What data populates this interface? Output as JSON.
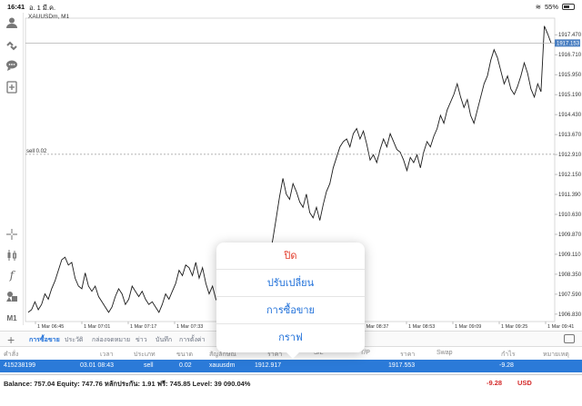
{
  "status_bar": {
    "time": "16:41",
    "date": "อ. 1 มี.ค.",
    "battery": "55%"
  },
  "chart": {
    "symbol_title": "XAUUSDm, M1",
    "sell_line_label": "sell 0.02",
    "current_price_label": "1917.153"
  },
  "sidebar": {
    "timeframe_label": "M1"
  },
  "chart_data": {
    "type": "line",
    "title": "XAUUSDm, M1",
    "y_ticks": [
      "1917.470",
      "1916.710",
      "1915.950",
      "1915.190",
      "1914.430",
      "1913.670",
      "1912.910",
      "1912.150",
      "1911.390",
      "1910.630",
      "1909.870",
      "1909.110",
      "1908.350",
      "1907.590",
      "1906.830"
    ],
    "x_ticks": [
      "1 Mar 06:45",
      "1 Mar 07:01",
      "1 Mar 07:17",
      "1 Mar 07:33",
      "1 Mar 07:49",
      "1 Mar 08:05",
      "1 Mar 08:21",
      "1 Mar 08:37",
      "1 Mar 08:53",
      "1 Mar 09:09",
      "1 Mar 09:25",
      "1 Mar 09:41"
    ],
    "ylim": [
      1906.55,
      1918.1
    ],
    "sell_level": 1912.917,
    "current_price": 1917.153,
    "series": [
      {
        "values": [
          1906.9,
          1907.0,
          1907.3,
          1907.0,
          1907.2,
          1907.6,
          1907.4,
          1907.8,
          1908.1,
          1908.5,
          1908.9,
          1909.0,
          1908.7,
          1908.8,
          1908.2,
          1907.9,
          1907.8,
          1908.4,
          1907.9,
          1907.7,
          1907.9,
          1907.5,
          1907.3,
          1907.1,
          1906.9,
          1907.1,
          1907.5,
          1907.8,
          1907.6,
          1907.2,
          1907.4,
          1907.9,
          1907.7,
          1907.5,
          1907.7,
          1907.4,
          1907.2,
          1907.3,
          1907.1,
          1906.9,
          1907.2,
          1907.6,
          1907.4,
          1907.7,
          1908.0,
          1908.5,
          1908.3,
          1908.7,
          1908.6,
          1908.3,
          1908.8,
          1908.2,
          1908.6,
          1908.0,
          1907.6,
          1907.9,
          1907.4,
          1907.2,
          1906.9,
          1907.1,
          1906.95,
          1907.3,
          1907.6,
          1907.9,
          1907.6,
          1908.2,
          1908.5,
          1908.3,
          1908.8,
          1908.6,
          1909.1,
          1909.4,
          1909.0,
          1909.7,
          1910.5,
          1911.3,
          1912.0,
          1911.4,
          1911.2,
          1911.8,
          1911.5,
          1911.1,
          1910.9,
          1911.4,
          1910.7,
          1910.5,
          1910.9,
          1910.4,
          1911.0,
          1911.5,
          1911.8,
          1912.4,
          1912.8,
          1913.2,
          1913.4,
          1913.5,
          1913.2,
          1913.7,
          1913.9,
          1913.5,
          1913.8,
          1913.3,
          1912.7,
          1912.9,
          1912.6,
          1913.1,
          1913.5,
          1913.2,
          1913.7,
          1913.4,
          1913.1,
          1913.0,
          1912.7,
          1912.3,
          1912.8,
          1912.6,
          1912.9,
          1912.4,
          1913.0,
          1913.4,
          1913.2,
          1913.6,
          1913.9,
          1914.4,
          1914.1,
          1914.6,
          1914.9,
          1915.2,
          1915.6,
          1915.1,
          1914.7,
          1915.0,
          1914.4,
          1914.1,
          1914.6,
          1915.1,
          1915.6,
          1915.9,
          1916.5,
          1916.9,
          1916.6,
          1916.1,
          1915.6,
          1915.9,
          1915.4,
          1915.2,
          1915.5,
          1915.9,
          1916.4,
          1916.0,
          1915.4,
          1915.1,
          1915.6,
          1915.3,
          1917.8,
          1917.5,
          1917.153
        ]
      }
    ]
  },
  "context_menu": {
    "items": [
      "ปิด",
      "ปรับเปลี่ยน",
      "การซื้อขาย",
      "กราฟ"
    ]
  },
  "tabs": {
    "items": [
      "การซื้อขาย",
      "ประวัติ",
      "กล่องจดหมาย",
      "ข่าว",
      "บันทึก",
      "การตั้งค่า"
    ]
  },
  "table": {
    "headers": [
      "คำสั่ง",
      "เวลา",
      "ประเภท",
      "ขนาด",
      "สัญลักษณ์",
      "ราคา",
      "S/L",
      "T/P",
      "ราคา",
      "Swap",
      "กำไร",
      "หมายเหตุ"
    ],
    "row": {
      "order": "415238199",
      "time": "03.01 08:43",
      "type": "sell",
      "size": "0.02",
      "symbol": "xauusdm",
      "open_price": "1912.917",
      "price": "1917.553",
      "profit": "-9.28"
    }
  },
  "balance_bar": {
    "text": "Balance: 757.04 Equity: 747.76 หลักประกัน: 1.91 ฟรี: 745.85 Level: 39 090.04%",
    "profit": "-9.28",
    "currency": "USD"
  },
  "colors": {
    "accent": "#1e6fd9",
    "danger": "#e23b2a",
    "row_highlight": "#2b7ad8",
    "price_tag": "#4a7fc1"
  }
}
